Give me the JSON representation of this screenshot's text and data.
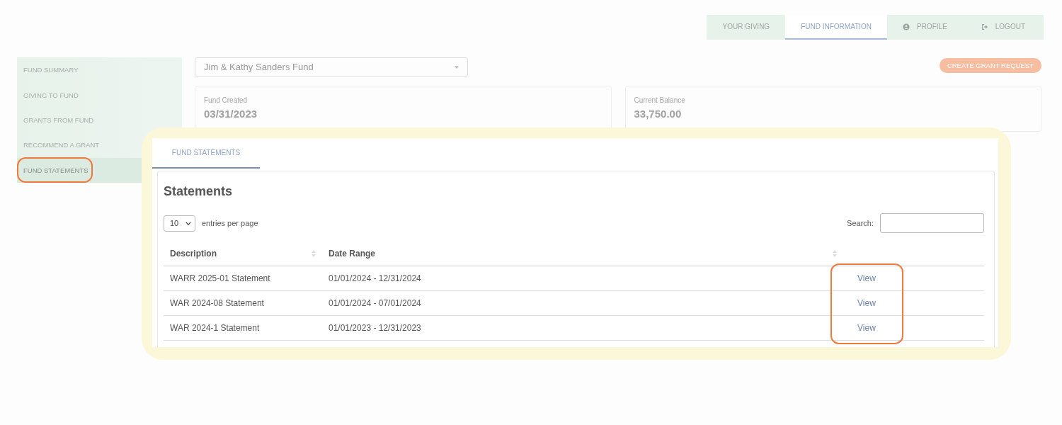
{
  "nav_tabs": [
    {
      "label": "YOUR GIVING",
      "kind": "plain",
      "selected": false
    },
    {
      "label": "FUND INFORMATION",
      "kind": "plain",
      "selected": true
    },
    {
      "label": "PROFILE",
      "kind": "profile",
      "selected": false
    },
    {
      "label": "LOGOUT",
      "kind": "logout",
      "selected": false
    }
  ],
  "sidebar": {
    "items": [
      {
        "label": "FUND SUMMARY",
        "selected": false
      },
      {
        "label": "GIVING TO FUND",
        "selected": false
      },
      {
        "label": "GRANTS FROM FUND",
        "selected": false
      },
      {
        "label": "RECOMMEND A GRANT",
        "selected": false
      },
      {
        "label": "FUND STATEMENTS",
        "selected": true
      }
    ]
  },
  "fund_select": {
    "value": "Jim & Kathy Sanders Fund"
  },
  "create_button": "CREATE GRANT REQUEST",
  "cards": [
    {
      "label": "Fund Created",
      "value": "03/31/2023"
    },
    {
      "label": "Current Balance",
      "value": "33,750.00"
    }
  ],
  "statements_panel": {
    "tab": "FUND STATEMENTS",
    "heading": "Statements",
    "page_size": "10",
    "page_size_label": "entries per page",
    "search_label": "Search:",
    "columns": [
      "Description",
      "Date Range"
    ],
    "rows": [
      {
        "description": "WARR 2025-01 Statement",
        "date_range": "01/01/2024 - 12/31/2024",
        "action": "View"
      },
      {
        "description": "WAR 2024-08 Statement",
        "date_range": "01/01/2024 - 07/01/2024",
        "action": "View"
      },
      {
        "description": "WAR 2024-1 Statement",
        "date_range": "01/01/2023 - 12/31/2023",
        "action": "View"
      }
    ]
  }
}
